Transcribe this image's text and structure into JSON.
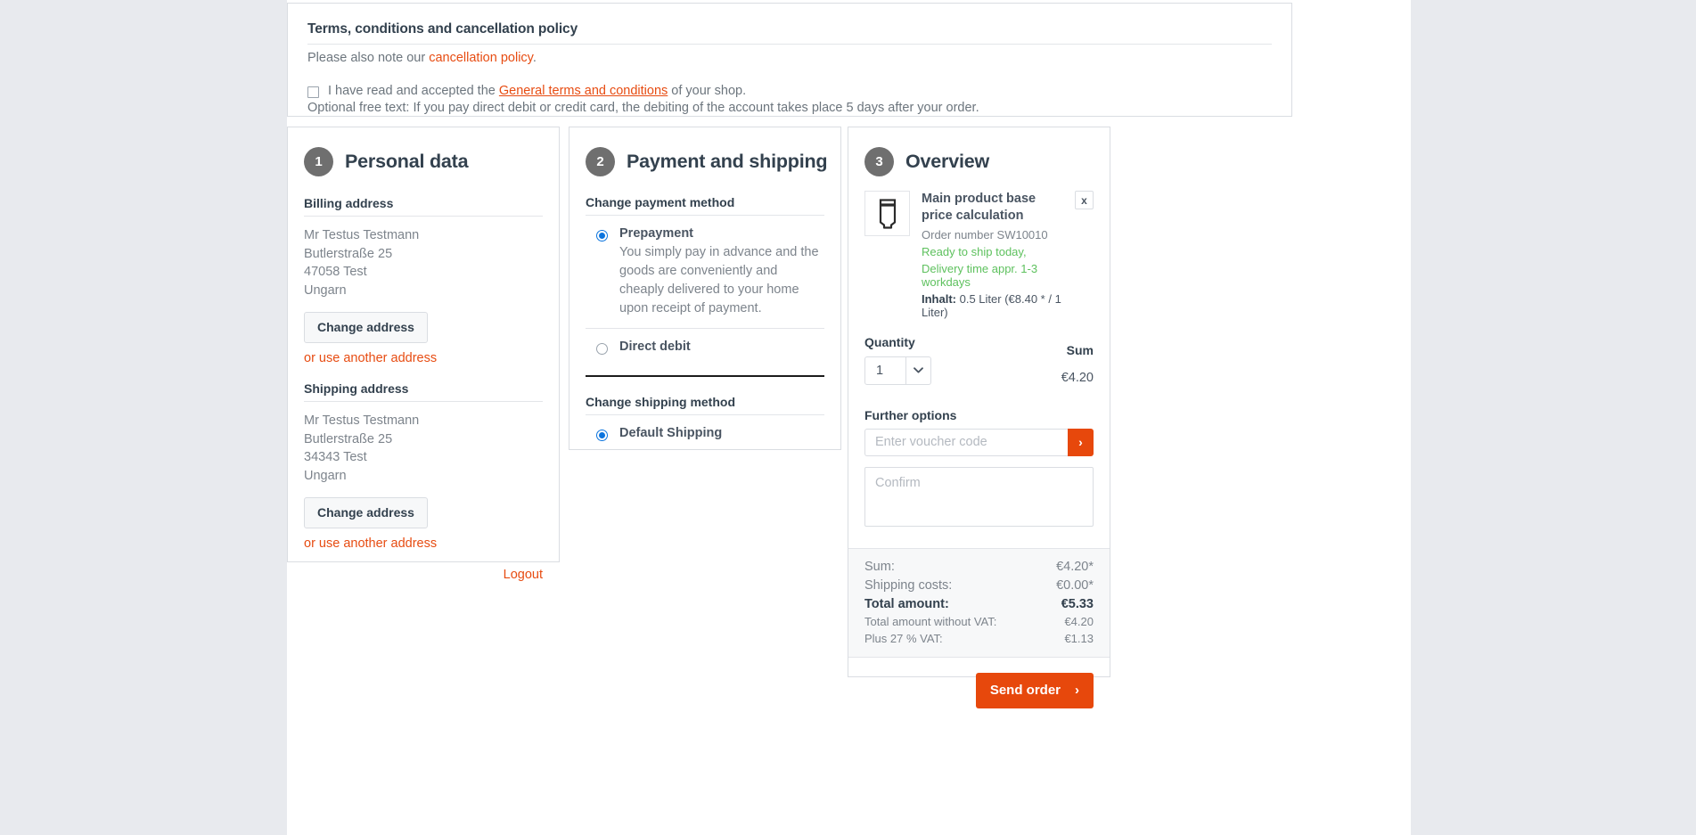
{
  "terms": {
    "title": "Terms, conditions and cancellation policy",
    "note_prefix": "Please also note our ",
    "note_link": "cancellation policy",
    "note_suffix": ".",
    "checkbox_prefix": "I have read and accepted the ",
    "checkbox_link": "General terms and conditions",
    "checkbox_suffix": " of your shop.",
    "free_text": "Optional free text: If you pay direct debit or credit card, the debiting of the account takes place 5 days after your order."
  },
  "step1": {
    "number": "1",
    "title": "Personal data",
    "billing_label": "Billing address",
    "billing_lines": [
      "Mr Testus Testmann",
      "Butlerstraße 25",
      "47058 Test",
      "Ungarn"
    ],
    "billing_change_label": "Change address",
    "billing_alt_label": "or use another address",
    "shipping_label": "Shipping address",
    "shipping_lines": [
      "Mr Testus Testmann",
      "Butlerstraße 25",
      "34343 Test",
      "Ungarn"
    ],
    "shipping_change_label": "Change address",
    "shipping_alt_label": "or use another address",
    "logout_label": "Logout"
  },
  "step2": {
    "number": "2",
    "title": "Payment and shipping",
    "payment_label": "Change payment method",
    "payment_options": [
      {
        "name": "Prepayment",
        "description": "You simply pay in advance and the goods are conveniently and cheaply delivered to your home upon receipt of payment.",
        "selected": true
      },
      {
        "name": "Direct debit",
        "description": "",
        "selected": false
      }
    ],
    "shipping_label": "Change shipping method",
    "shipping_options": [
      {
        "name": "Default Shipping",
        "selected": true
      }
    ]
  },
  "step3": {
    "number": "3",
    "title": "Overview",
    "product": {
      "thumb_icon": "tube-icon",
      "name": "Main product base price calculation",
      "order_number": "Order number SW10010",
      "stock_line1": "Ready to ship today,",
      "stock_line2": "Delivery time appr. 1-3 workdays",
      "inhalt_label": "Inhalt:",
      "inhalt_value": " 0.5 Liter (€8.40 * / 1 Liter)",
      "remove_label": "x"
    },
    "quantity_header": "Quantity",
    "sum_header": "Sum",
    "quantity_value": "1",
    "sum_value": "€4.20",
    "further_options_label": "Further options",
    "voucher_placeholder": "Enter voucher code",
    "voucher_value": "",
    "voucher_submit_label": "›",
    "confirm_placeholder": "Confirm",
    "confirm_value": "",
    "totals": [
      {
        "label": "Sum:",
        "value": "€4.20*",
        "style": "normal"
      },
      {
        "label": "Shipping costs:",
        "value": "€0.00*",
        "style": "normal"
      },
      {
        "label": "Total amount:",
        "value": "€5.33",
        "style": "strong"
      },
      {
        "label": "Total amount without VAT:",
        "value": "€4.20",
        "style": "small"
      },
      {
        "label": "Plus 27 % VAT:",
        "value": "€1.13",
        "style": "small"
      }
    ],
    "send_label": "Send order",
    "send_arrow": "›"
  },
  "colors": {
    "accent_orange": "#e7480c",
    "link_red": "#e74c12",
    "heading": "#33414e",
    "muted": "#7d848c",
    "stock_green": "#5ec15e",
    "radio_blue": "#0b74de",
    "page_bg": "#e8eaee"
  }
}
